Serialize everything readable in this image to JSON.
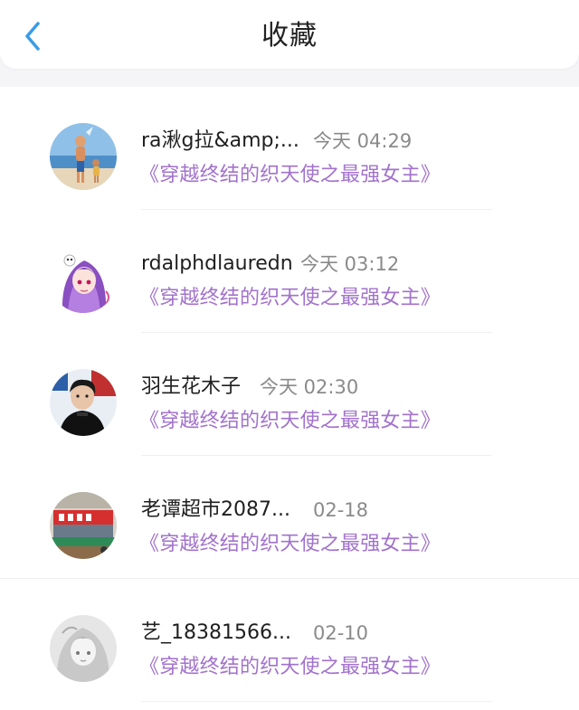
{
  "header": {
    "title": "收藏",
    "back_icon": "chevron-left-icon",
    "accent": "#3a9be6"
  },
  "book_color": "#a272cc",
  "items": [
    {
      "user": "ra湫g拉&amp;...",
      "time": "今天 04:29",
      "book": "《穿越终结的织天使之最强女主》",
      "avatar": "beach-photo-avatar"
    },
    {
      "user": "rdalphdlauredn",
      "time": "今天 03:12",
      "book": "《穿越终结的织天使之最强女主》",
      "avatar": "anime-girl-avatar"
    },
    {
      "user": "羽生花木子",
      "time": "今天 02:30",
      "book": "《穿越终结的织天使之最强女主》",
      "avatar": "person-photo-avatar"
    },
    {
      "user": "老谭超市2087...",
      "time": "02-18",
      "book": "《穿越终结的织天使之最强女主》",
      "avatar": "storefront-photo-avatar"
    },
    {
      "user": "艺_18381566...",
      "time": "02-10",
      "book": "《穿越终结的织天使之最强女主》",
      "avatar": "sketch-anime-avatar"
    }
  ]
}
